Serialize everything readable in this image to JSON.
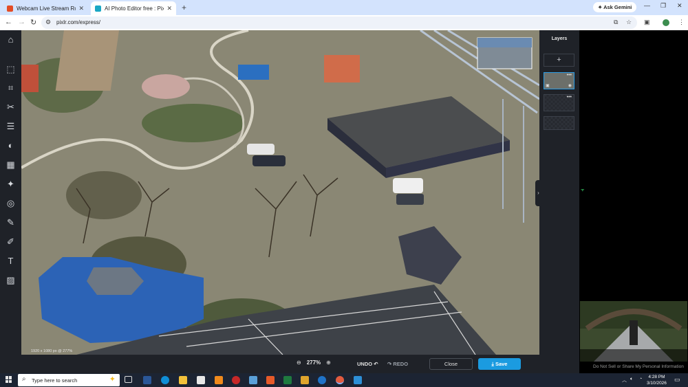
{
  "browser": {
    "tabs": [
      {
        "title": "Webcam Live Stream Roller Coa",
        "favicon_color": "#e34c26",
        "active": false
      },
      {
        "title": "AI Photo Editor free : Pixlr Expre",
        "favicon_color": "#1aa7c4",
        "active": true
      }
    ],
    "new_tab": "+",
    "ask_gemini": "Ask Gemini",
    "url": "pixlr.com/express/",
    "window_controls": {
      "minimize": "—",
      "restore": "❐",
      "close": "✕"
    }
  },
  "editor": {
    "tools": [
      "arrange",
      "crop",
      "cutout",
      "adjust",
      "filter",
      "effect",
      "retouch",
      "liquify",
      "draw",
      "brush",
      "text",
      "elements"
    ],
    "image_info": "1920 x 1080 px @ 277%",
    "layers_panel": {
      "title": "Layers",
      "add_label": "+",
      "layers": [
        {
          "active": true,
          "menu": "•••",
          "visible": true
        },
        {
          "active": false,
          "menu": "•••",
          "visible": false
        },
        {
          "active": false,
          "menu": "",
          "visible": false
        }
      ]
    },
    "bottom_bar": {
      "zoom_out": "⊖",
      "zoom": "277%",
      "zoom_in": "⊕",
      "undo": "UNDO",
      "redo": "REDO",
      "close": "Close",
      "save": "Save"
    }
  },
  "ad": {
    "do_not_sell": "Do Not Sell or Share My Personal Information"
  },
  "taskbar": {
    "search_placeholder": "Type here to search",
    "time": "4:28 PM",
    "date": "3/10/2026"
  },
  "colors": {
    "accent": "#1b9be0",
    "panel": "#1f2228",
    "tabstrip": "#d3e3fd"
  }
}
